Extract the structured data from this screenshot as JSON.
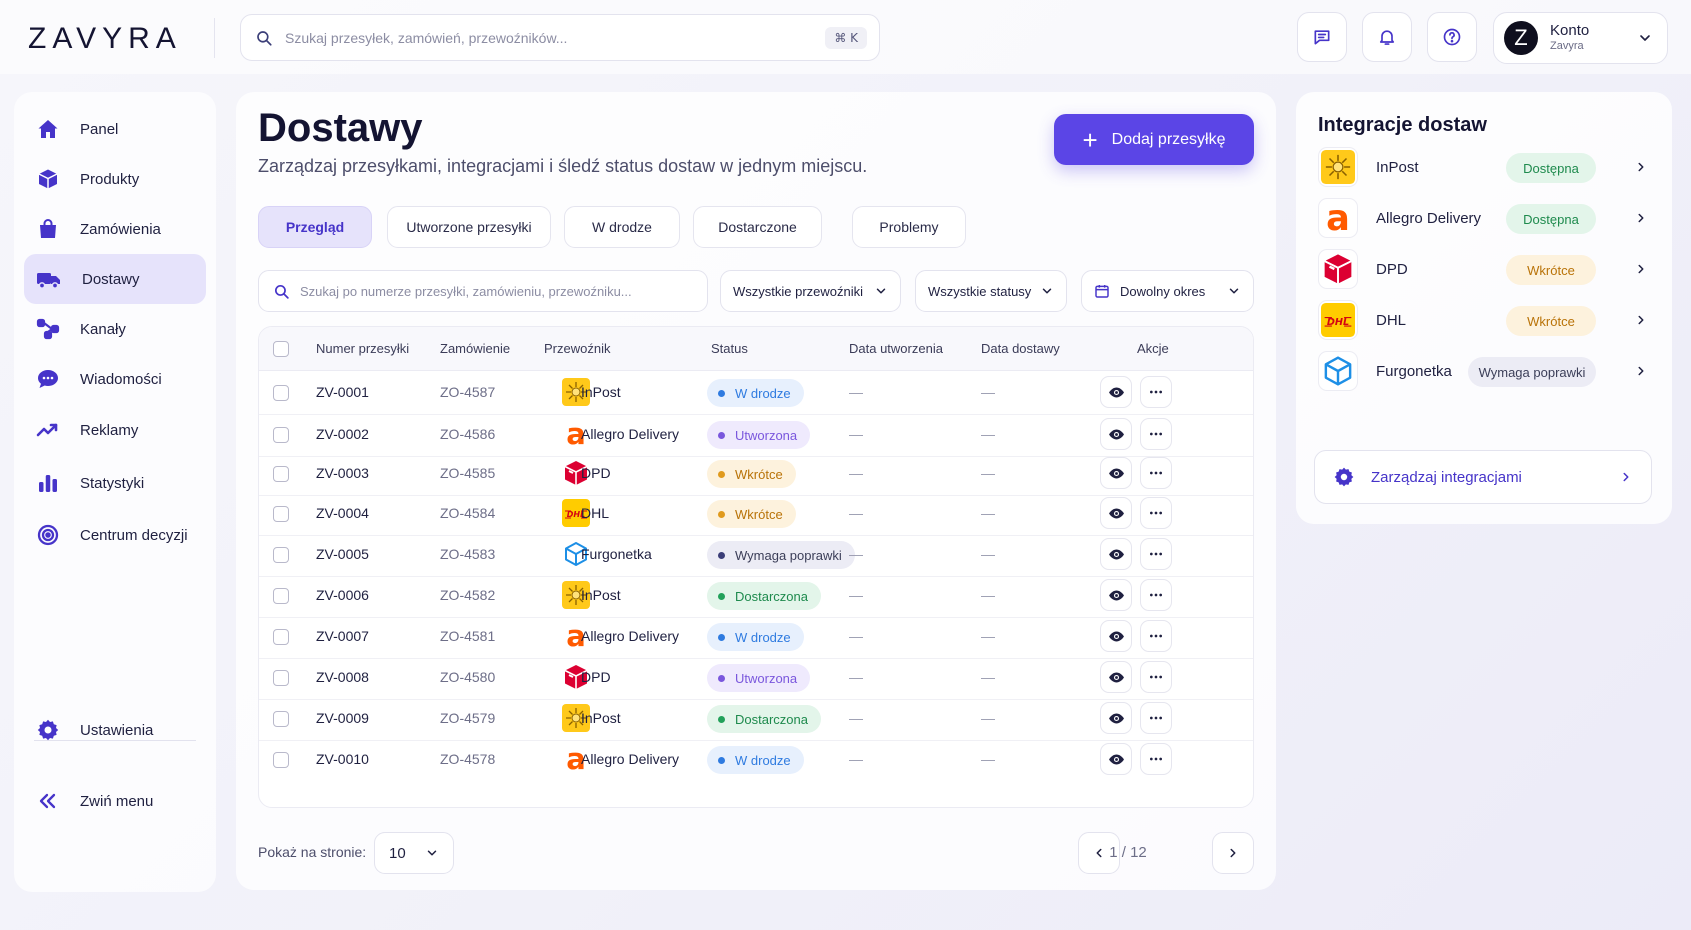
{
  "app": {
    "logo": "ZAVYRA"
  },
  "topbar": {
    "search_placeholder": "Szukaj przesyłek, zamówień, przewoźników...",
    "shortcut": "⌘ K",
    "account": {
      "initial": "Z",
      "title": "Konto",
      "subtitle": "Zavyra"
    }
  },
  "sidebar": {
    "items": [
      {
        "label": "Panel",
        "icon": "home-icon"
      },
      {
        "label": "Produkty",
        "icon": "box-icon"
      },
      {
        "label": "Zamówienia",
        "icon": "shopping-bag-icon"
      },
      {
        "label": "Dostawy",
        "icon": "truck-icon",
        "active": true
      },
      {
        "label": "Kanały",
        "icon": "channels-icon"
      },
      {
        "label": "Wiadomości",
        "icon": "chat-icon"
      },
      {
        "label": "Reklamy",
        "icon": "trend-icon"
      },
      {
        "label": "Statystyki",
        "icon": "bar-chart-icon"
      },
      {
        "label": "Centrum decyzji",
        "icon": "target-icon"
      }
    ],
    "settings": "Ustawienia",
    "collapse": "Zwiń menu"
  },
  "main": {
    "title": "Dostawy",
    "subtitle": "Zarządzaj przesyłkami, integracjami i śledź status dostaw w jednym miejscu.",
    "add_button": "Dodaj przesyłkę",
    "tabs": [
      "Przegląd",
      "Utworzone przesyłki",
      "W drodze",
      "Dostarczone",
      "Problemy"
    ],
    "filter_search_placeholder": "Szukaj po numerze przesyłki, zamówieniu, przewoźniku...",
    "filters": {
      "carriers": "Wszystkie przewoźniki",
      "statuses": "Wszystkie statusy",
      "period": "Dowolny okres"
    },
    "table": {
      "headers": [
        "Numer przesyłki",
        "Zamówienie",
        "Przewoźnik",
        "Status",
        "Data utworzenia",
        "Data dostawy",
        "Akcje"
      ],
      "rows": [
        {
          "num": "ZV-0001",
          "order": "ZO-4587",
          "carrier": "InPost",
          "status": "W drodze",
          "created": "—",
          "delivered": "—"
        },
        {
          "num": "ZV-0002",
          "order": "ZO-4586",
          "carrier": "Allegro Delivery",
          "status": "Utworzona",
          "created": "—",
          "delivered": "—"
        },
        {
          "num": "ZV-0003",
          "order": "ZO-4585",
          "carrier": "DPD",
          "status": "Wkrótce",
          "created": "—",
          "delivered": "—"
        },
        {
          "num": "ZV-0004",
          "order": "ZO-4584",
          "carrier": "DHL",
          "status": "Wkrótce",
          "created": "—",
          "delivered": "—"
        },
        {
          "num": "ZV-0005",
          "order": "ZO-4583",
          "carrier": "Furgonetka",
          "status": "Wymaga poprawki",
          "created": "—",
          "delivered": "—"
        },
        {
          "num": "ZV-0006",
          "order": "ZO-4582",
          "carrier": "InPost",
          "status": "Dostarczona",
          "created": "—",
          "delivered": "—"
        },
        {
          "num": "ZV-0007",
          "order": "ZO-4581",
          "carrier": "Allegro Delivery",
          "status": "W drodze",
          "created": "—",
          "delivered": "—"
        },
        {
          "num": "ZV-0008",
          "order": "ZO-4580",
          "carrier": "DPD",
          "status": "Utworzona",
          "created": "—",
          "delivered": "—"
        },
        {
          "num": "ZV-0009",
          "order": "ZO-4579",
          "carrier": "InPost",
          "status": "Dostarczona",
          "created": "—",
          "delivered": "—"
        },
        {
          "num": "ZV-0010",
          "order": "ZO-4578",
          "carrier": "Allegro Delivery",
          "status": "W drodze",
          "created": "—",
          "delivered": "—"
        }
      ]
    },
    "pagination": {
      "per_page_label": "Pokaż na stronie:",
      "per_page": "10",
      "page_text": "1 / 12"
    }
  },
  "integrations": {
    "title": "Integracje dostaw",
    "items": [
      {
        "name": "InPost",
        "status": "Dostępna"
      },
      {
        "name": "Allegro Delivery",
        "status": "Dostępna"
      },
      {
        "name": "DPD",
        "status": "Wkrótce"
      },
      {
        "name": "DHL",
        "status": "Wkrótce"
      },
      {
        "name": "Furgonetka",
        "status": "Wymaga poprawki"
      }
    ],
    "manage": "Zarządzaj integracjami"
  },
  "colors": {
    "accent": "#5b45e6",
    "status_in_transit": "#2f7be0",
    "status_created": "#7a57dd",
    "status_soon": "#d88a12",
    "status_fix": "#3b3e78",
    "status_delivered": "#22a15a"
  }
}
